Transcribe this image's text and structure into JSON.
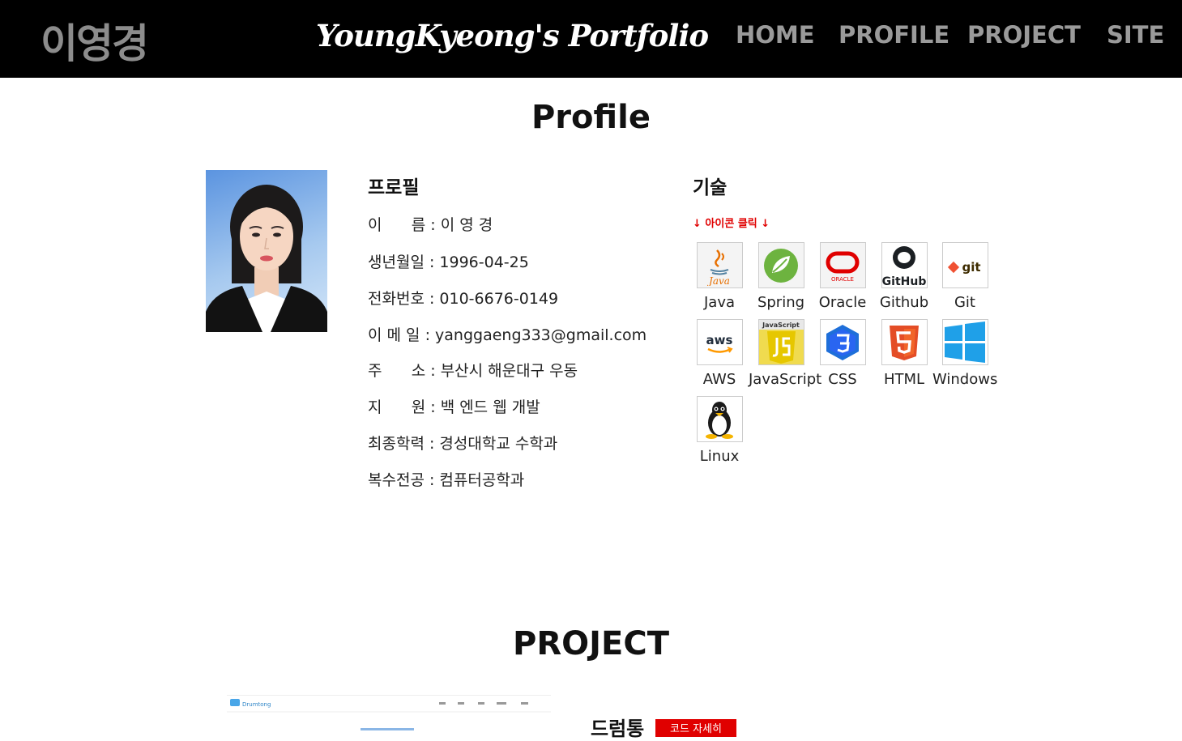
{
  "header": {
    "brand": "이영경",
    "site_title": "YoungKyeong's Portfolio",
    "nav": [
      "HOME",
      "PROFILE",
      "PROJECT",
      "SITE"
    ]
  },
  "profile_section": {
    "title": "Profile",
    "profile_heading": "프로필",
    "info": [
      {
        "label": "이      름",
        "value": "이 영 경"
      },
      {
        "label": "생년월일",
        "value": "1996-04-25"
      },
      {
        "label": "전화번호",
        "value": "010-6676-0149"
      },
      {
        "label": "이 메 일",
        "value": "yanggaeng333@gmail.com"
      },
      {
        "label": "주      소",
        "value": "부산시 해운대구 우동"
      },
      {
        "label": "지      원",
        "value": "백 엔드 웹 개발"
      },
      {
        "label": "최종학력",
        "value": "경성대학교 수학과"
      },
      {
        "label": "복수전공",
        "value": "컴퓨터공학과"
      }
    ],
    "skills_heading": "기술",
    "skills_hint": "↓ 아이콘 클릭 ↓",
    "skills": [
      {
        "name": "Java",
        "icon": "java-icon"
      },
      {
        "name": "Spring",
        "icon": "spring-icon"
      },
      {
        "name": "Oracle",
        "icon": "oracle-icon"
      },
      {
        "name": "Github",
        "icon": "github-icon"
      },
      {
        "name": "Git",
        "icon": "git-icon"
      },
      {
        "name": "AWS",
        "icon": "aws-icon"
      },
      {
        "name": "JavaScript",
        "icon": "javascript-icon"
      },
      {
        "name": "CSS",
        "icon": "css-icon"
      },
      {
        "name": "HTML",
        "icon": "html-icon"
      },
      {
        "name": "Windows",
        "icon": "windows-icon"
      },
      {
        "name": "Linux",
        "icon": "linux-icon"
      }
    ],
    "icon_text": {
      "java": "Java",
      "oracle": "ORACLE",
      "github": "GitHub",
      "git": "git",
      "aws": "aws",
      "javascript": "JavaScript"
    }
  },
  "project_section": {
    "title": "PROJECT",
    "project_name": "드럼통",
    "code_button": "코드 자세히",
    "thumb_logo": "Drumtong"
  },
  "colors": {
    "header_bg": "#000000",
    "nav_text": "#9a9a9a",
    "accent_red": "#e00000"
  }
}
